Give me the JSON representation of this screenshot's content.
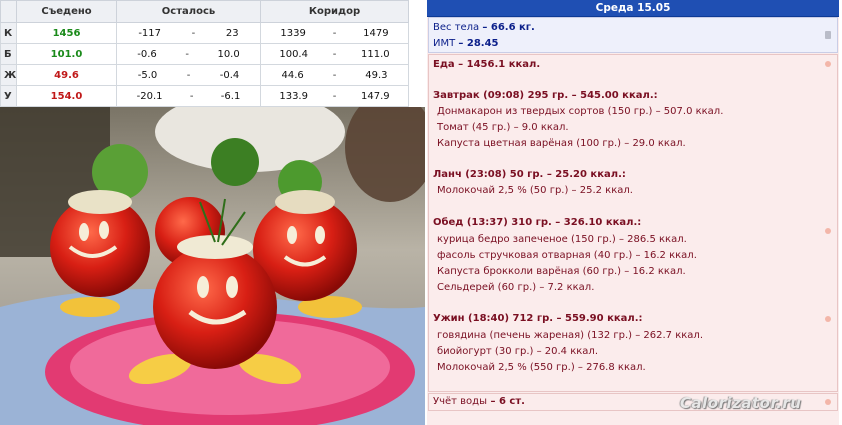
{
  "nutrition_table": {
    "headers": {
      "eaten": "Съедено",
      "remaining": "Осталось",
      "corridor": "Коридор"
    },
    "rows": [
      {
        "key": "К",
        "eaten": "1456",
        "eaten_color": "#1a8a1a",
        "rem_min": "-117",
        "sep1": "-",
        "rem_max": "23",
        "cor_min": "1339",
        "sep2": "-",
        "cor_max": "1479"
      },
      {
        "key": "Б",
        "eaten": "101.0",
        "eaten_color": "#1a8a1a",
        "rem_min": "-0.6",
        "sep1": "-",
        "rem_max": "10.0",
        "cor_min": "100.4",
        "sep2": "-",
        "cor_max": "111.0"
      },
      {
        "key": "Ж",
        "eaten": "49.6",
        "eaten_color": "#c01818",
        "rem_min": "-5.0",
        "sep1": "-",
        "rem_max": "-0.4",
        "cor_min": "44.6",
        "sep2": "-",
        "cor_max": "49.3"
      },
      {
        "key": "У",
        "eaten": "154.0",
        "eaten_color": "#c01818",
        "rem_min": "-20.1",
        "sep1": "-",
        "rem_max": "-6.1",
        "cor_min": "133.9",
        "sep2": "-",
        "cor_max": "147.9"
      }
    ]
  },
  "diary": {
    "day_title": "Среда 15.05",
    "body": {
      "weight_label": "Вес тела",
      "weight_value": "– 66.6 кг.",
      "bmi_label": "ИМТ",
      "bmi_value": "– 28.45"
    },
    "food_total": {
      "label": "Еда",
      "value": "– 1456.1 ккал."
    },
    "meals": [
      {
        "title": "Завтрак (09:08) 295 гр. – 545.00 ккал.:",
        "items": [
          "Донмакарон из твердых сортов (150 гр.) – 507.0 ккал.",
          "Томат (45 гр.) – 9.0 ккал.",
          "Капуста цветная варёная (100 гр.) – 29.0 ккал."
        ]
      },
      {
        "title": "Ланч (23:08) 50 гр. – 25.20 ккал.:",
        "items": [
          "Молокочай 2,5 % (50 гр.) – 25.2 ккал."
        ]
      },
      {
        "title": "Обед (13:37) 310 гр. – 326.10 ккал.:",
        "items": [
          "курица бедро запеченое (150 гр.) – 286.5 ккал.",
          "фасоль стручковая отварная (40 гр.) – 16.2 ккал.",
          "Капуста брокколи варёная (60 гр.) – 16.2 ккал.",
          "Сельдерей (60 гр.) – 7.2 ккал."
        ]
      },
      {
        "title": "Ужин (18:40) 712 гр. – 559.90 ккал.:",
        "items": [
          "говядина (печень жареная) (132 гр.) – 262.7 ккал.",
          "биойогурт (30 гр.) – 20.4 ккал.",
          "Молокочай 2,5 % (550 гр.) – 276.8 ккал."
        ]
      }
    ],
    "water": {
      "label": "Учёт воды",
      "value": "– 6 ст."
    }
  },
  "watermark": "Calorizator.ru",
  "colors": {
    "header_blue": "#1f4fb3",
    "diary_bg": "#fbecec",
    "diary_text": "#7a0f22",
    "body_text": "#0b1f8a",
    "good": "#1a8a1a",
    "bad": "#c01818"
  }
}
